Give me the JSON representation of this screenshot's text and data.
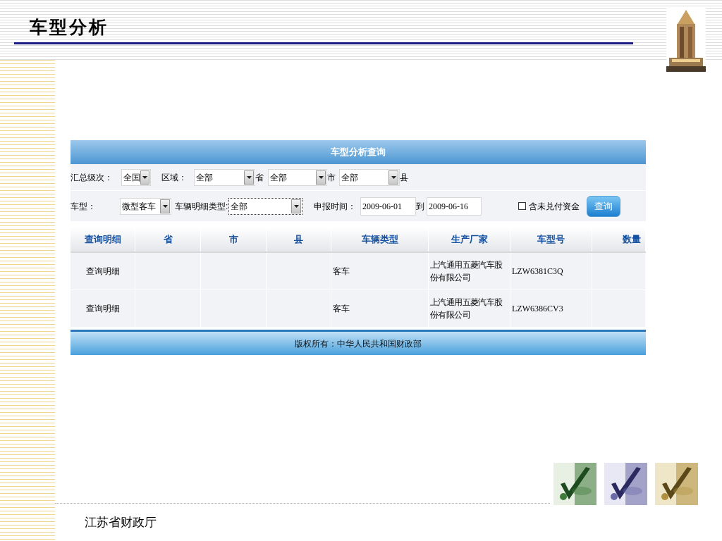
{
  "slide": {
    "title": "车型分析",
    "footer": "江苏省财政厅"
  },
  "panel": {
    "title": "车型分析查询",
    "filter_rows": [
      [
        {
          "kind": "label",
          "text": "汇总级次："
        },
        {
          "kind": "select",
          "value": "全国",
          "focused": false
        },
        {
          "kind": "label",
          "text": "区域："
        },
        {
          "kind": "select",
          "value": "全部",
          "focused": false
        },
        {
          "kind": "label",
          "text": "省"
        },
        {
          "kind": "select",
          "value": "全部",
          "focused": false
        },
        {
          "kind": "label",
          "text": "市"
        },
        {
          "kind": "select",
          "value": "全部",
          "focused": false
        },
        {
          "kind": "label",
          "text": "县"
        }
      ],
      [
        {
          "kind": "label",
          "text": "车型："
        },
        {
          "kind": "select",
          "value": "微型客车",
          "focused": false
        },
        {
          "kind": "label",
          "text": "车辆明细类型:"
        },
        {
          "kind": "select",
          "value": "全部",
          "focused": true
        },
        {
          "kind": "label",
          "text": "申报时间："
        },
        {
          "kind": "input",
          "value": "2009-06-01"
        },
        {
          "kind": "label",
          "text": "到"
        },
        {
          "kind": "input",
          "value": "2009-06-16"
        },
        {
          "kind": "checkbox",
          "text": "含未兑付资金",
          "checked": false
        },
        {
          "kind": "button",
          "text": "查询"
        }
      ]
    ],
    "table": {
      "columns": [
        "查询明细",
        "省",
        "市",
        "县",
        "车辆类型",
        "生产厂家",
        "车型号",
        "数量"
      ],
      "rows": [
        {
          "detail": "查询明细",
          "vehicle_type": "客车",
          "manufacturer": "上汽通用五菱汽车股份有限公司",
          "model": "LZW6381C3Q"
        },
        {
          "detail": "查询明细",
          "vehicle_type": "客车",
          "manufacturer": "上汽通用五菱汽车股份有限公司",
          "model": "LZW6386CV3"
        }
      ]
    },
    "footer": "版权所有：中华人民共和国财政部"
  }
}
